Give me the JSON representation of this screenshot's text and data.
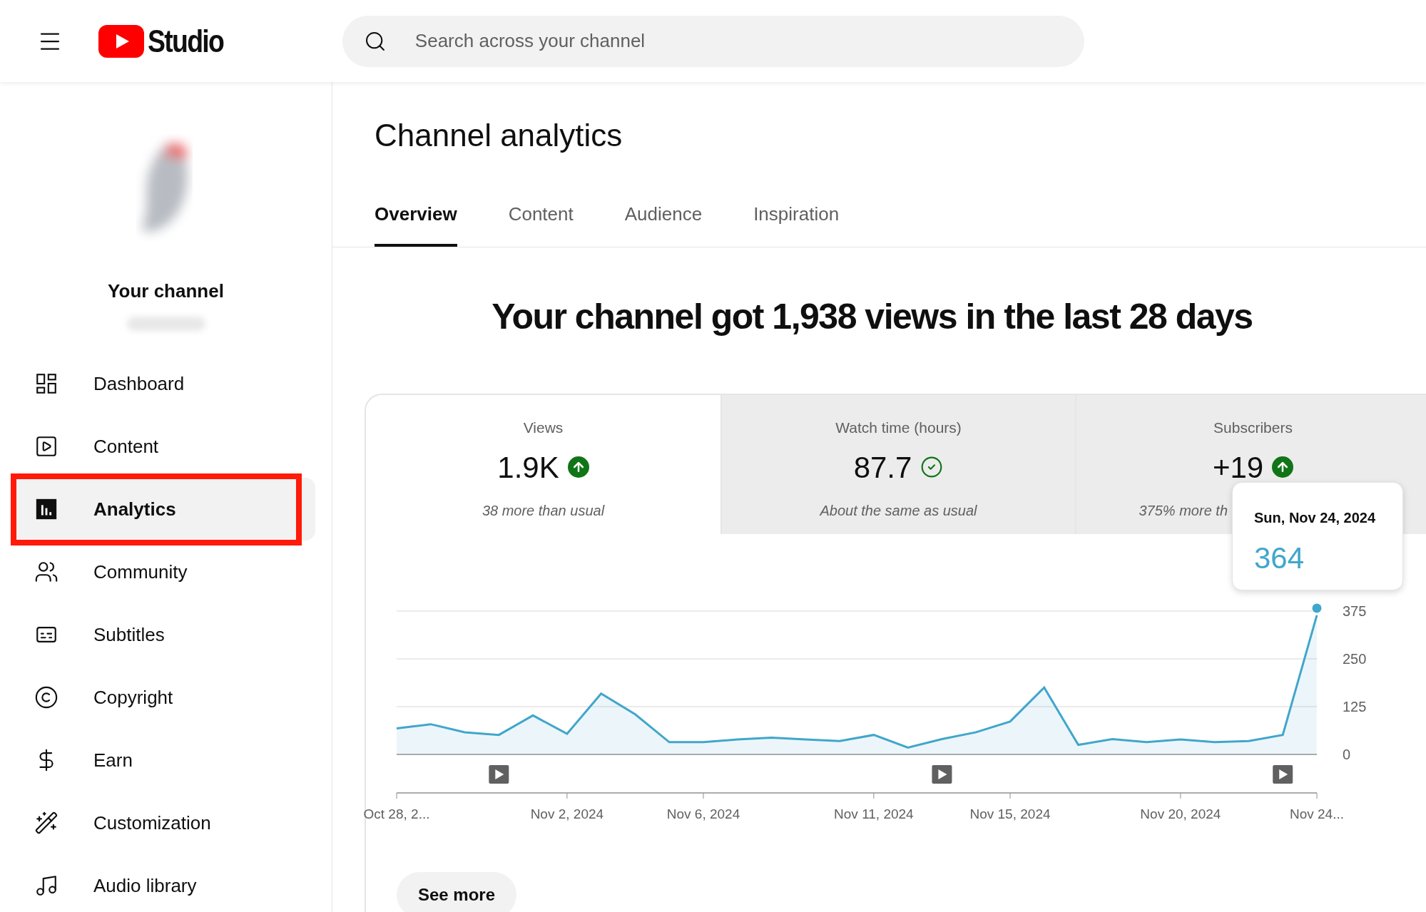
{
  "header": {
    "logo_text": "Studio",
    "search": {
      "placeholder": "Search across your channel"
    }
  },
  "sidebar": {
    "channel_label": "Your channel",
    "items": [
      {
        "label": "Dashboard",
        "kind": "dashboard",
        "selected": false,
        "highlighted": false
      },
      {
        "label": "Content",
        "kind": "content",
        "selected": false,
        "highlighted": false
      },
      {
        "label": "Analytics",
        "kind": "analytics",
        "selected": true,
        "highlighted": true
      },
      {
        "label": "Community",
        "kind": "community",
        "selected": false,
        "highlighted": false
      },
      {
        "label": "Subtitles",
        "kind": "subtitles",
        "selected": false,
        "highlighted": false
      },
      {
        "label": "Copyright",
        "kind": "copyright",
        "selected": false,
        "highlighted": false
      },
      {
        "label": "Earn",
        "kind": "earn",
        "selected": false,
        "highlighted": false
      },
      {
        "label": "Customization",
        "kind": "customization",
        "selected": false,
        "highlighted": false
      },
      {
        "label": "Audio library",
        "kind": "audio",
        "selected": false,
        "highlighted": false
      }
    ]
  },
  "page": {
    "title": "Channel analytics",
    "tabs": [
      {
        "label": "Overview",
        "selected": true
      },
      {
        "label": "Content",
        "selected": false
      },
      {
        "label": "Audience",
        "selected": false
      },
      {
        "label": "Inspiration",
        "selected": false
      }
    ],
    "headline": "Your channel got 1,938 views in the last 28 days",
    "metrics": [
      {
        "label": "Views",
        "value": "1.9K",
        "kind": "up",
        "note": "38 more than usual",
        "selected": true
      },
      {
        "label": "Watch time (hours)",
        "value": "87.7",
        "kind": "same",
        "note": "About the same as usual",
        "selected": false
      },
      {
        "label": "Subscribers",
        "value": "+19",
        "kind": "up",
        "note": "375% more th",
        "selected": false
      }
    ],
    "chart": {
      "tooltip": {
        "date": "Sun, Nov 24, 2024",
        "value": "364"
      },
      "chart_data": {
        "type": "area",
        "categories": [
          "Oct 28, 2...",
          null,
          null,
          null,
          null,
          "Nov 2, 2024",
          null,
          null,
          null,
          "Nov 6, 2024",
          null,
          null,
          null,
          null,
          "Nov 11, 2024",
          null,
          null,
          null,
          "Nov 15, 2024",
          null,
          null,
          null,
          null,
          "Nov 20, 2024",
          null,
          null,
          null,
          "Nov 24..."
        ],
        "series": [
          {
            "color": "#41a6cb",
            "values": [
              68,
              79,
              58,
              51,
              102,
              54,
              159,
              105,
              32,
              32,
              39,
              44,
              39,
              35,
              51,
              18,
              40,
              58,
              86,
              175,
              25,
              40,
              32,
              39,
              32,
              35,
              51,
              364
            ]
          }
        ],
        "ylim": [
          0,
          375
        ],
        "yticks": [
          0,
          125,
          250,
          375
        ]
      }
    },
    "see_more": "See more"
  }
}
